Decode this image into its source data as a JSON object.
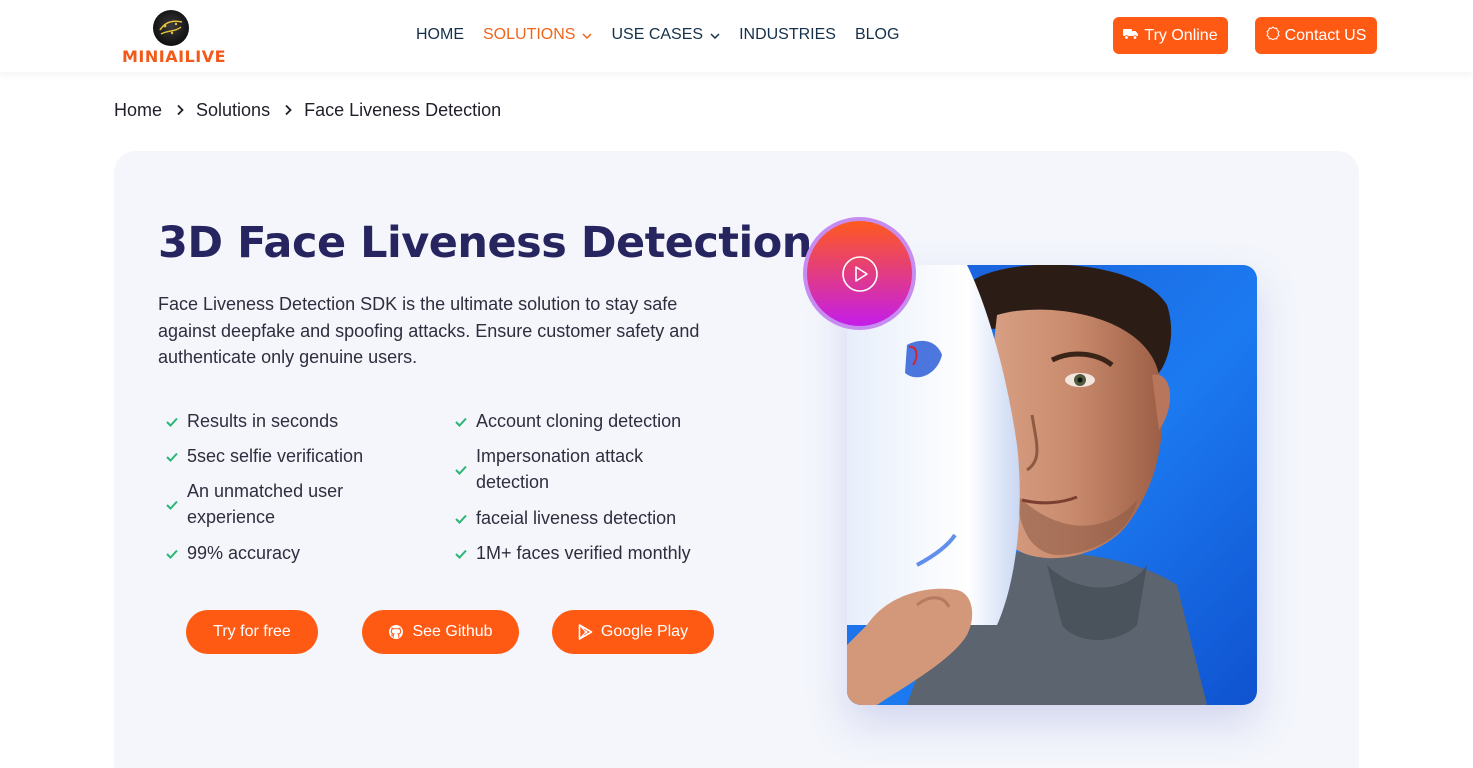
{
  "header": {
    "logo_text": "MINIAILIVE",
    "nav": [
      {
        "label": "HOME",
        "active": false,
        "dropdown": false
      },
      {
        "label": "SOLUTIONS",
        "active": true,
        "dropdown": true
      },
      {
        "label": "USE CASES",
        "active": false,
        "dropdown": true
      },
      {
        "label": "INDUSTRIES",
        "active": false,
        "dropdown": false
      },
      {
        "label": "BLOG",
        "active": false,
        "dropdown": false
      }
    ],
    "try_online_label": "Try Online",
    "contact_label": "Contact US"
  },
  "breadcrumb": [
    "Home",
    "Solutions",
    "Face Liveness Detection"
  ],
  "hero": {
    "title": "3D Face Liveness Detection",
    "description": "Face Liveness Detection SDK is the ultimate solution to stay safe against deepfake and spoofing attacks. Ensure customer safety and authenticate only genuine users.",
    "features_left": [
      "Results in seconds",
      "5sec selfie verification",
      "An unmatched user experience",
      "99% accuracy"
    ],
    "features_right": [
      "Account cloning detection",
      "Impersonation attack detection",
      "faceial liveness detection",
      "1M+ faces verified monthly"
    ],
    "buttons": {
      "try_free": "Try for free",
      "github": "See Github",
      "google_play": "Google Play"
    }
  },
  "colors": {
    "accent": "#ff5a14",
    "title": "#27255f",
    "nav_text": "#14304a",
    "check": "#2bb673",
    "card_bg": "#f4f6fc"
  },
  "icons": {
    "try_online": "truck-icon",
    "contact": "badge-icon",
    "github": "github-icon",
    "google_play": "play-store-icon",
    "video": "play-circle-icon"
  }
}
